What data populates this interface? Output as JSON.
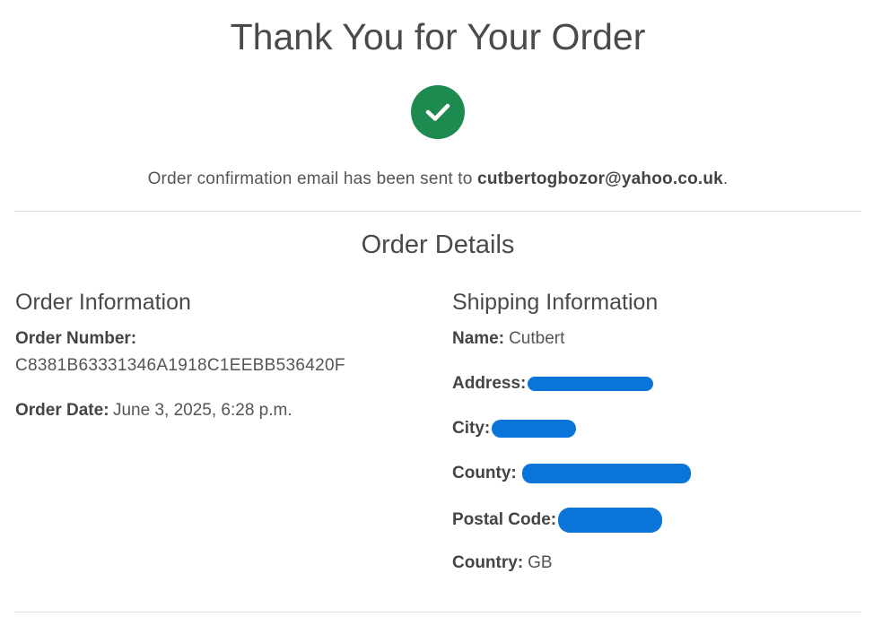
{
  "header": {
    "title": "Thank You for Your Order",
    "confirmation_prefix": "Order confirmation email has been sent to ",
    "confirmation_email": "cutbertogbozor@yahoo.co.uk",
    "confirmation_suffix": "."
  },
  "status": {
    "icon": "check-circle-icon",
    "color": "#1d8a4f"
  },
  "order_details": {
    "title": "Order Details",
    "order_information": {
      "heading": "Order Information",
      "order_number_label": "Order Number:",
      "order_number_value": "C8381B63331346A1918C1EEBB536420F",
      "order_date_label": "Order Date:",
      "order_date_value": "June 3, 2025, 6:28 p.m."
    },
    "shipping_information": {
      "heading": "Shipping Information",
      "name_label": "Name:",
      "name_value": "Cutbert",
      "address_label": "Address:",
      "city_label": "City:",
      "county_label": "County:",
      "postal_code_label": "Postal Code:",
      "country_label": "Country:",
      "country_value": "GB",
      "redaction_color": "#0a74d8"
    }
  }
}
